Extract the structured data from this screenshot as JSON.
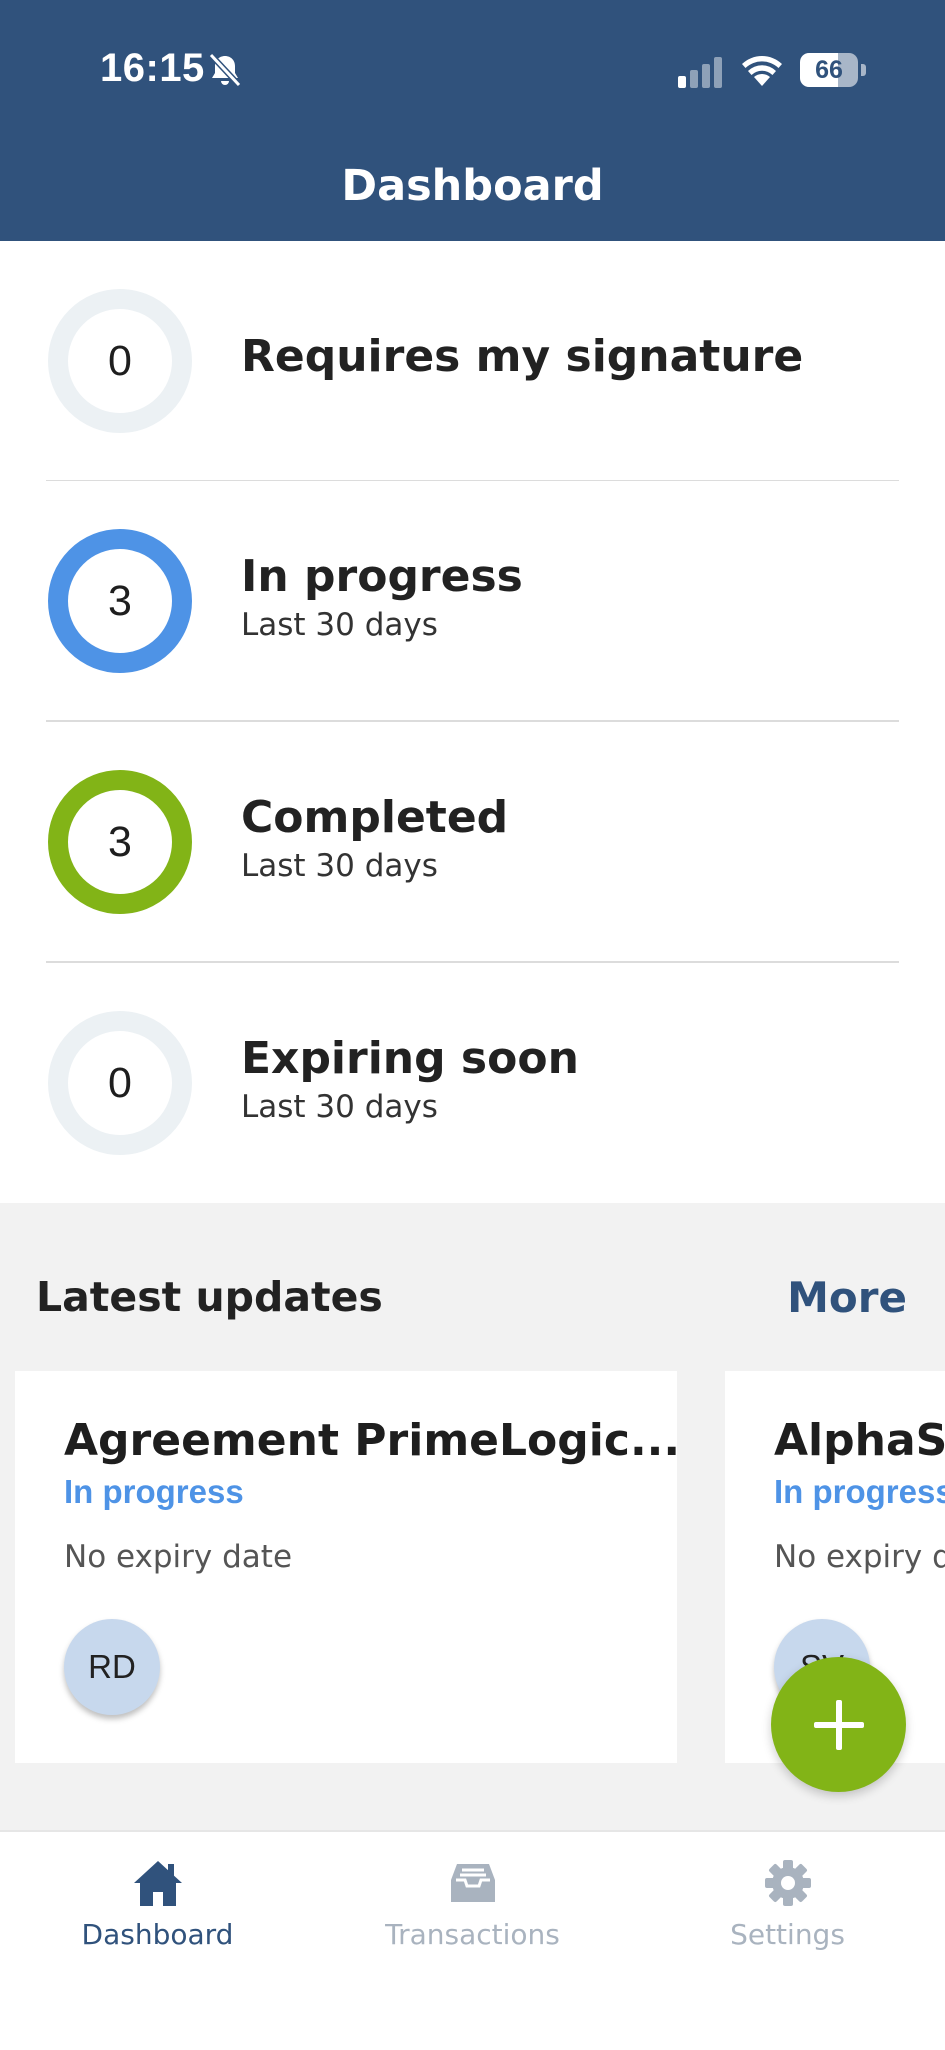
{
  "status_bar": {
    "time": "16:15",
    "battery_level": "66"
  },
  "header": {
    "title": "Dashboard"
  },
  "stats": [
    {
      "count": "0",
      "title": "Requires my signature",
      "subtitle": ""
    },
    {
      "count": "3",
      "title": "In progress",
      "subtitle": "Last 30 days"
    },
    {
      "count": "3",
      "title": "Completed",
      "subtitle": "Last 30 days"
    },
    {
      "count": "0",
      "title": "Expiring soon",
      "subtitle": "Last 30 days"
    }
  ],
  "updates": {
    "title": "Latest updates",
    "more_label": "More",
    "cards": [
      {
        "title": "Agreement PrimeLogic...",
        "status": "In progress",
        "expiry": "No expiry date",
        "avatar": "RD"
      },
      {
        "title": "AlphaSp",
        "status": "In progress",
        "expiry": "No expiry date",
        "avatar": "SV"
      }
    ]
  },
  "tabs": [
    {
      "label": "Dashboard",
      "icon": "home-icon",
      "active": true
    },
    {
      "label": "Transactions",
      "icon": "inbox-tray-icon",
      "active": false
    },
    {
      "label": "Settings",
      "icon": "gear-icon",
      "active": false
    }
  ],
  "colors": {
    "header": "#30527c",
    "in_progress": "#4e93e6",
    "completed": "#82b417",
    "empty_ring": "#ecf1f4",
    "fab": "#82b417",
    "tab_active": "#30527c",
    "tab_inactive": "#a9b3bf"
  }
}
